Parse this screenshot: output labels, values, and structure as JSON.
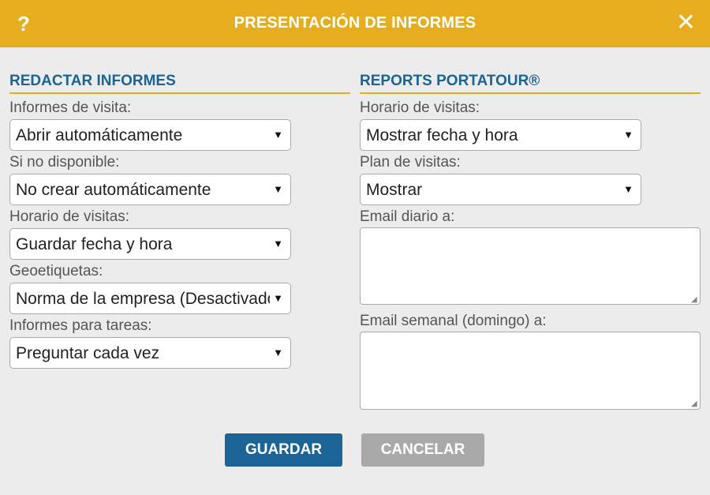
{
  "header": {
    "help_label": "?",
    "title": "PRESENTACIÓN DE INFORMES",
    "close_label": "✕"
  },
  "left": {
    "section_title": "REDACTAR INFORMES",
    "fields": [
      {
        "label": "Informes de visita:",
        "value": "Abrir automáticamente"
      },
      {
        "label": "Si no disponible:",
        "value": "No crear automáticamente"
      },
      {
        "label": "Horario de visitas:",
        "value": "Guardar fecha y hora"
      },
      {
        "label": "Geoetiquetas:",
        "value": "Norma de la empresa (Desactivado)"
      },
      {
        "label": "Informes para tareas:",
        "value": "Preguntar cada vez"
      }
    ]
  },
  "right": {
    "section_title": "REPORTS PORTATOUR®",
    "fields": [
      {
        "label": "Horario de visitas:",
        "value": "Mostrar fecha y hora"
      },
      {
        "label": "Plan de visitas:",
        "value": "Mostrar"
      }
    ],
    "textareas": [
      {
        "label": "Email diario a:",
        "value": ""
      },
      {
        "label": "Email semanal (domingo) a:",
        "value": ""
      }
    ]
  },
  "buttons": {
    "save_label": "GUARDAR",
    "cancel_label": "CANCELAR"
  },
  "icons": {
    "dropdown_arrow": "▼",
    "resize_grip": "◢"
  },
  "colors": {
    "header": "#e6ae1f",
    "accent_blue": "#1a6496",
    "cancel_gray": "#a9a9a9"
  }
}
